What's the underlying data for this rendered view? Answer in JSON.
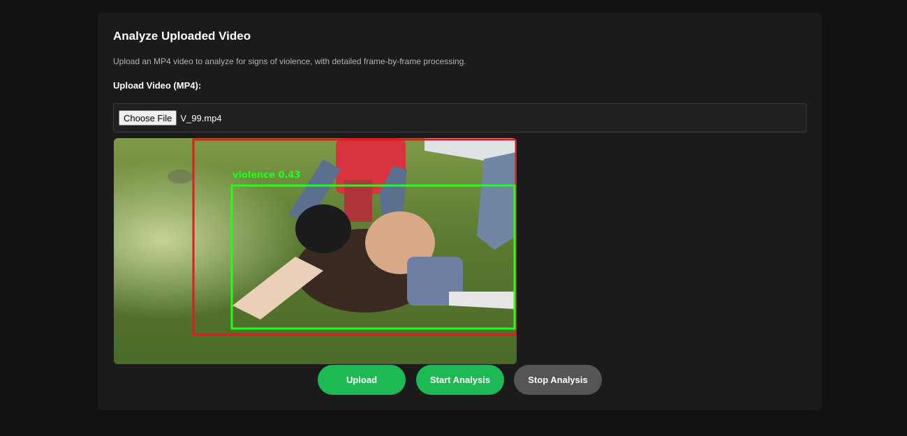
{
  "section": {
    "title": "Analyze Uploaded Video",
    "description": "Upload an MP4 video to analyze for signs of violence, with detailed frame-by-frame processing.",
    "upload_label": "Upload Video (MP4):"
  },
  "file_input": {
    "button_label": "Choose File",
    "file_name": "V_99.mp4"
  },
  "video": {
    "detection_label": "violence 0.43",
    "box_colors": {
      "outer": "#e01b1b",
      "detection": "#1dff1d"
    }
  },
  "buttons": {
    "upload": "Upload",
    "start": "Start Analysis",
    "stop": "Stop Analysis"
  },
  "colors": {
    "accent": "#1db954",
    "stop_button": "#555555",
    "background": "#121212",
    "card": "#1b1b1b"
  }
}
